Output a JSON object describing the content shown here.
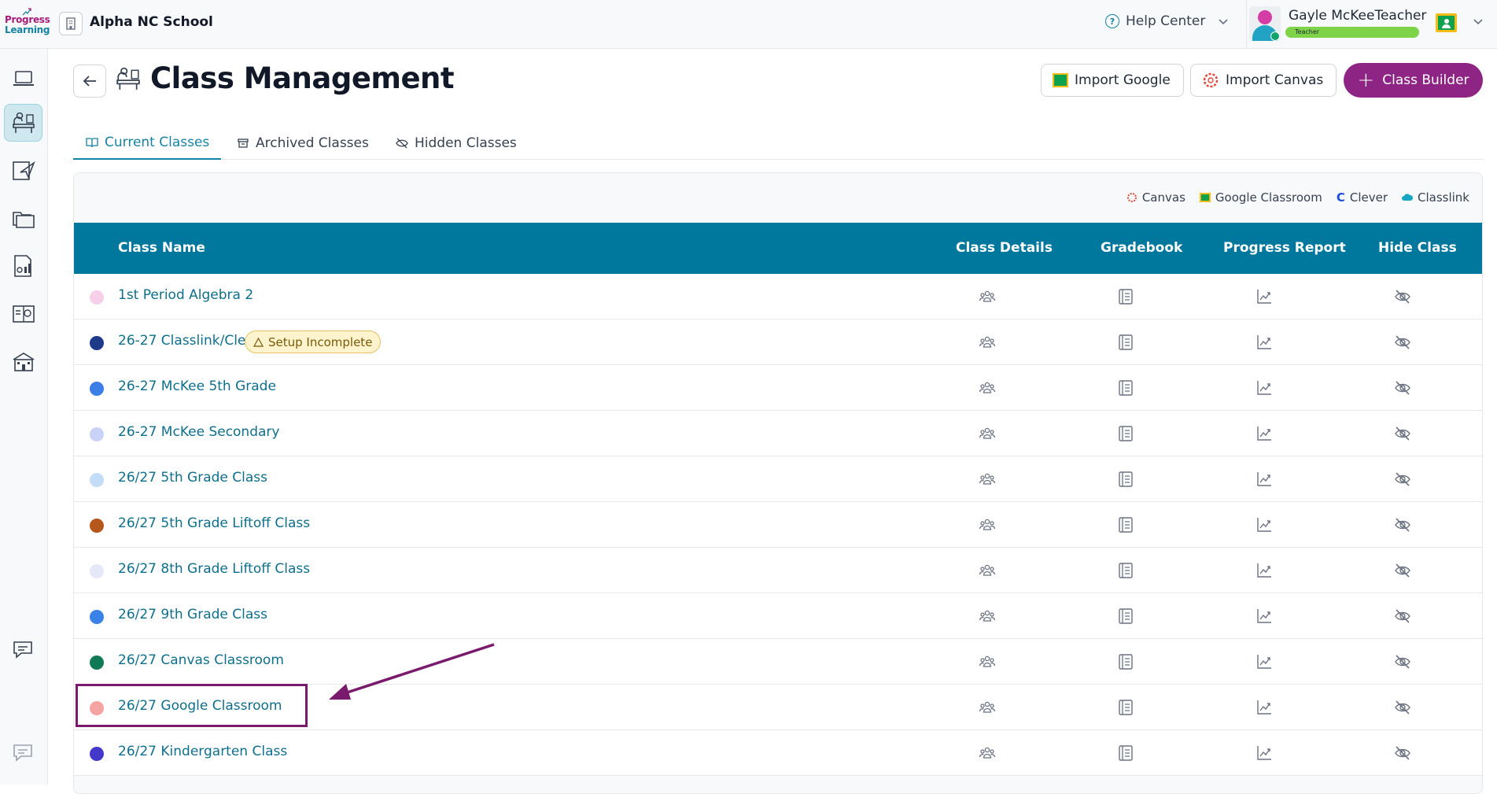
{
  "brand": {
    "line1": "Progress",
    "line2": "Learning"
  },
  "school": {
    "name": "Alpha NC School"
  },
  "header": {
    "help_label": "Help Center"
  },
  "user": {
    "name": "Gayle McKeeTeacher",
    "role": "Teacher"
  },
  "page": {
    "title": "Class Management",
    "buttons": {
      "import_google": "Import Google",
      "import_canvas": "Import Canvas",
      "class_builder": "Class Builder"
    },
    "tabs": [
      "Current Classes",
      "Archived Classes",
      "Hidden Classes"
    ],
    "active_tab": "Current Classes"
  },
  "legend": [
    "Canvas",
    "Google Classroom",
    "Clever",
    "Classlink"
  ],
  "table": {
    "columns": [
      "Class Name",
      "Class Details",
      "Gradebook",
      "Progress Report",
      "Hide Class"
    ],
    "rows": [
      {
        "name": "1st Period Algebra 2",
        "color": "#f7cfe8",
        "badge": ""
      },
      {
        "name": "26-27 Classlink/Clever",
        "color": "#1e3a8a",
        "badge": "Setup Incomplete"
      },
      {
        "name": "26-27 McKee 5th Grade",
        "color": "#3b7ee8",
        "badge": ""
      },
      {
        "name": "26-27 McKee Secondary",
        "color": "#c9d3f7",
        "badge": ""
      },
      {
        "name": "26/27 5th Grade Class",
        "color": "#c3dcf7",
        "badge": ""
      },
      {
        "name": "26/27 5th Grade Liftoff Class",
        "color": "#b5561b",
        "badge": ""
      },
      {
        "name": "26/27 8th Grade Liftoff Class",
        "color": "#e4e8f7",
        "badge": ""
      },
      {
        "name": "26/27 9th Grade Class",
        "color": "#3b82e8",
        "badge": ""
      },
      {
        "name": "26/27 Canvas Classroom",
        "color": "#0f7a55",
        "badge": ""
      },
      {
        "name": "26/27 Google Classroom",
        "color": "#f5a3a3",
        "badge": ""
      },
      {
        "name": "26/27 Kindergarten Class",
        "color": "#4338ca",
        "badge": ""
      }
    ]
  },
  "colors": {
    "accent": "#1683a1",
    "table_header": "#00779c",
    "brand_purple": "#8e2585",
    "annotation": "#7a1a6c"
  }
}
